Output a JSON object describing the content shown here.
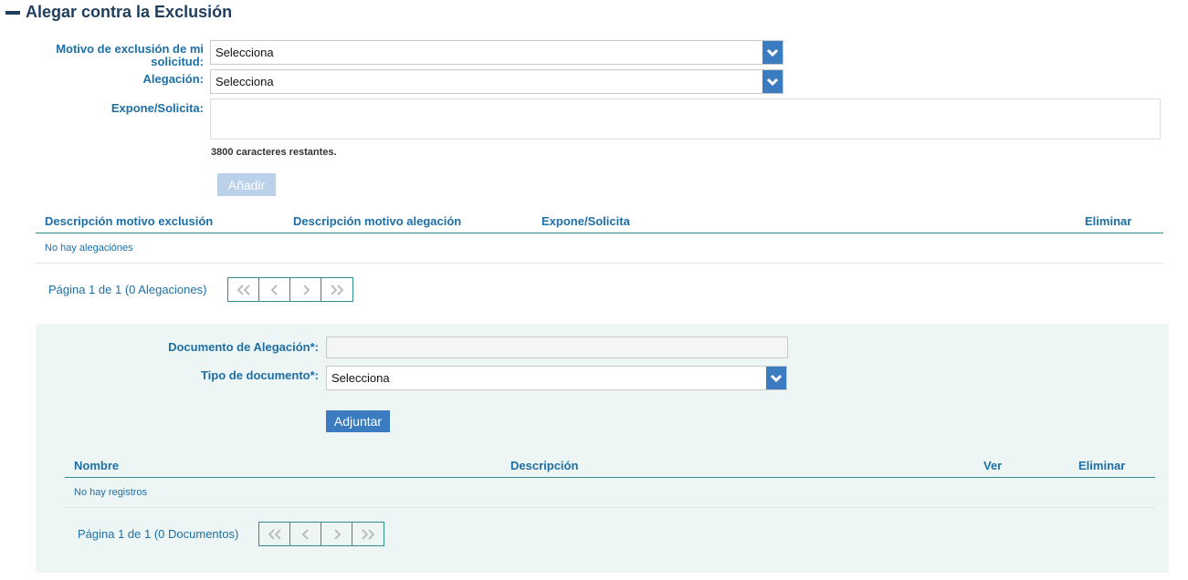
{
  "section": {
    "title": "Alegar contra la Exclusión"
  },
  "form": {
    "motivo_label": "Motivo de exclusión de mi solicitud:",
    "motivo_value": "Selecciona",
    "alegacion_label": "Alegación:",
    "alegacion_value": "Selecciona",
    "expone_label": "Expone/Solicita:",
    "expone_value": "",
    "counter": "3800 caracteres restantes.",
    "add_label": "Añadir"
  },
  "alegaciones_table": {
    "headers": [
      "Descripción motivo exclusión",
      "Descripción motivo alegación",
      "Expone/Solicita",
      "Eliminar"
    ],
    "empty": "No hay alegaciónes",
    "pager_text": "Página 1 de 1 (0 Alegaciones)"
  },
  "documents": {
    "doc_label": "Documento de Alegación*:",
    "doc_value": "",
    "tipo_label": "Tipo de documento*:",
    "tipo_value": "Selecciona",
    "attach_label": "Adjuntar",
    "headers": [
      "Nombre",
      "Descripción",
      "Ver",
      "Eliminar"
    ],
    "empty": "No hay registros",
    "pager_text": "Página 1 de 1 (0 Documentos)"
  },
  "pager_icons": [
    "first-page-icon",
    "prev-page-icon",
    "next-page-icon",
    "last-page-icon"
  ],
  "colors": {
    "accent": "#3b7bbf",
    "text_blue": "#1d6fa5",
    "teal_line": "#2f8f8f",
    "panel_bg": "#edf5f5",
    "title": "#1f3d5c"
  }
}
